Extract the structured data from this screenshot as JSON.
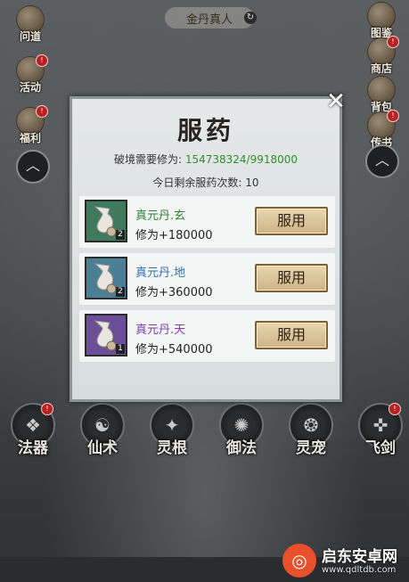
{
  "header": {
    "title": "金丹真人",
    "refresh_icon": "refresh-icon"
  },
  "left_menu": [
    {
      "label": "问道",
      "icon": "scroll-icon",
      "badge": ""
    },
    {
      "label": "活动",
      "icon": "lantern-icon",
      "badge": "!"
    },
    {
      "label": "福利",
      "icon": "gift-icon",
      "badge": "!"
    }
  ],
  "right_menu": [
    {
      "label": "图鉴",
      "icon": "book-icon",
      "badge": ""
    },
    {
      "label": "商店",
      "icon": "shop-icon",
      "badge": "!"
    },
    {
      "label": "背包",
      "icon": "bag-icon",
      "badge": ""
    },
    {
      "label": "传书",
      "icon": "letter-icon",
      "badge": "!"
    }
  ],
  "skills": [
    {
      "label": "法器",
      "badge": "!"
    },
    {
      "label": "仙术",
      "badge": ""
    },
    {
      "label": "灵根",
      "badge": ""
    },
    {
      "label": "御法",
      "badge": ""
    },
    {
      "label": "灵宠",
      "badge": ""
    },
    {
      "label": "飞剑",
      "badge": "!"
    }
  ],
  "dialog": {
    "title": "服药",
    "need_label": "破境需要修为:",
    "need_value": "154738324/9918000",
    "count_label": "今日剩余服药次数:",
    "count_value": "10",
    "pills": [
      {
        "name": "真元丹.玄",
        "exp": "修为+180000",
        "qty": "2",
        "button": "服用",
        "name_color": "#2f7f3a",
        "thumb_color": "#3f7a5c"
      },
      {
        "name": "真元丹.地",
        "exp": "修为+360000",
        "qty": "2",
        "button": "服用",
        "name_color": "#2f6fa8",
        "thumb_color": "#4a7f95"
      },
      {
        "name": "真元丹.天",
        "exp": "修为+540000",
        "qty": "1",
        "button": "服用",
        "name_color": "#7b3fa0",
        "thumb_color": "#6a4f96"
      }
    ],
    "close_icon": "close-icon"
  },
  "watermark": {
    "title": "启东安卓网",
    "url": "www.qdltdb.com"
  }
}
